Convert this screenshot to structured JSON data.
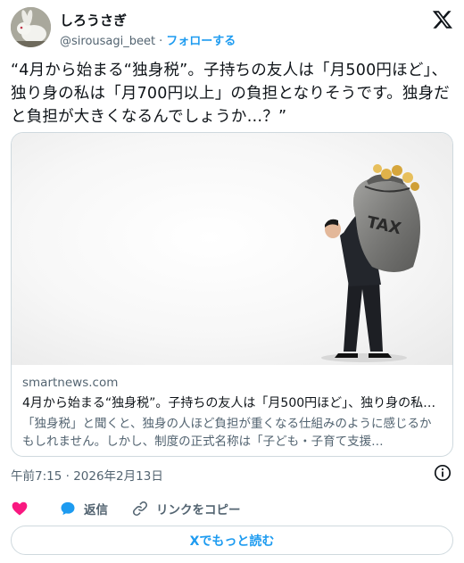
{
  "author": {
    "name": "しろうさぎ",
    "handle": "@sirousagi_beet",
    "separator": "·",
    "follow_label": "フォローする"
  },
  "tweet": {
    "text": "“4月から始まる“独身税”。子持ちの友人は「月500円ほど」、独り身の私は「月700円以上」の負担となりそうです。独身だと負担が大きくなるんでしょうか…？”"
  },
  "card": {
    "domain": "smartnews.com",
    "title": "4月から始まる“独身税”。子持ちの友人は「月500円ほど」、独り身の私…",
    "description": "「独身税」と聞くと、独身の人ほど負担が重くなる仕組みのように感じるかもしれません。しかし、制度の正式名称は「子ども・子育て支援…",
    "image_label": "TAX"
  },
  "timestamp": "午前7:15 · 2026年2月13日",
  "actions": {
    "like_label": "",
    "reply_label": "返信",
    "copy_link_label": "リンクをコピー"
  },
  "read_more_label": "Xでもっと読む",
  "colors": {
    "accent": "#1d9bf0",
    "like": "#f91880",
    "secondary_text": "#536471",
    "border": "#cfd9de"
  },
  "icons": {
    "logo": "x-logo-icon",
    "info": "info-icon",
    "like": "heart-icon",
    "reply": "reply-bubble-icon",
    "copy_link": "link-icon"
  }
}
